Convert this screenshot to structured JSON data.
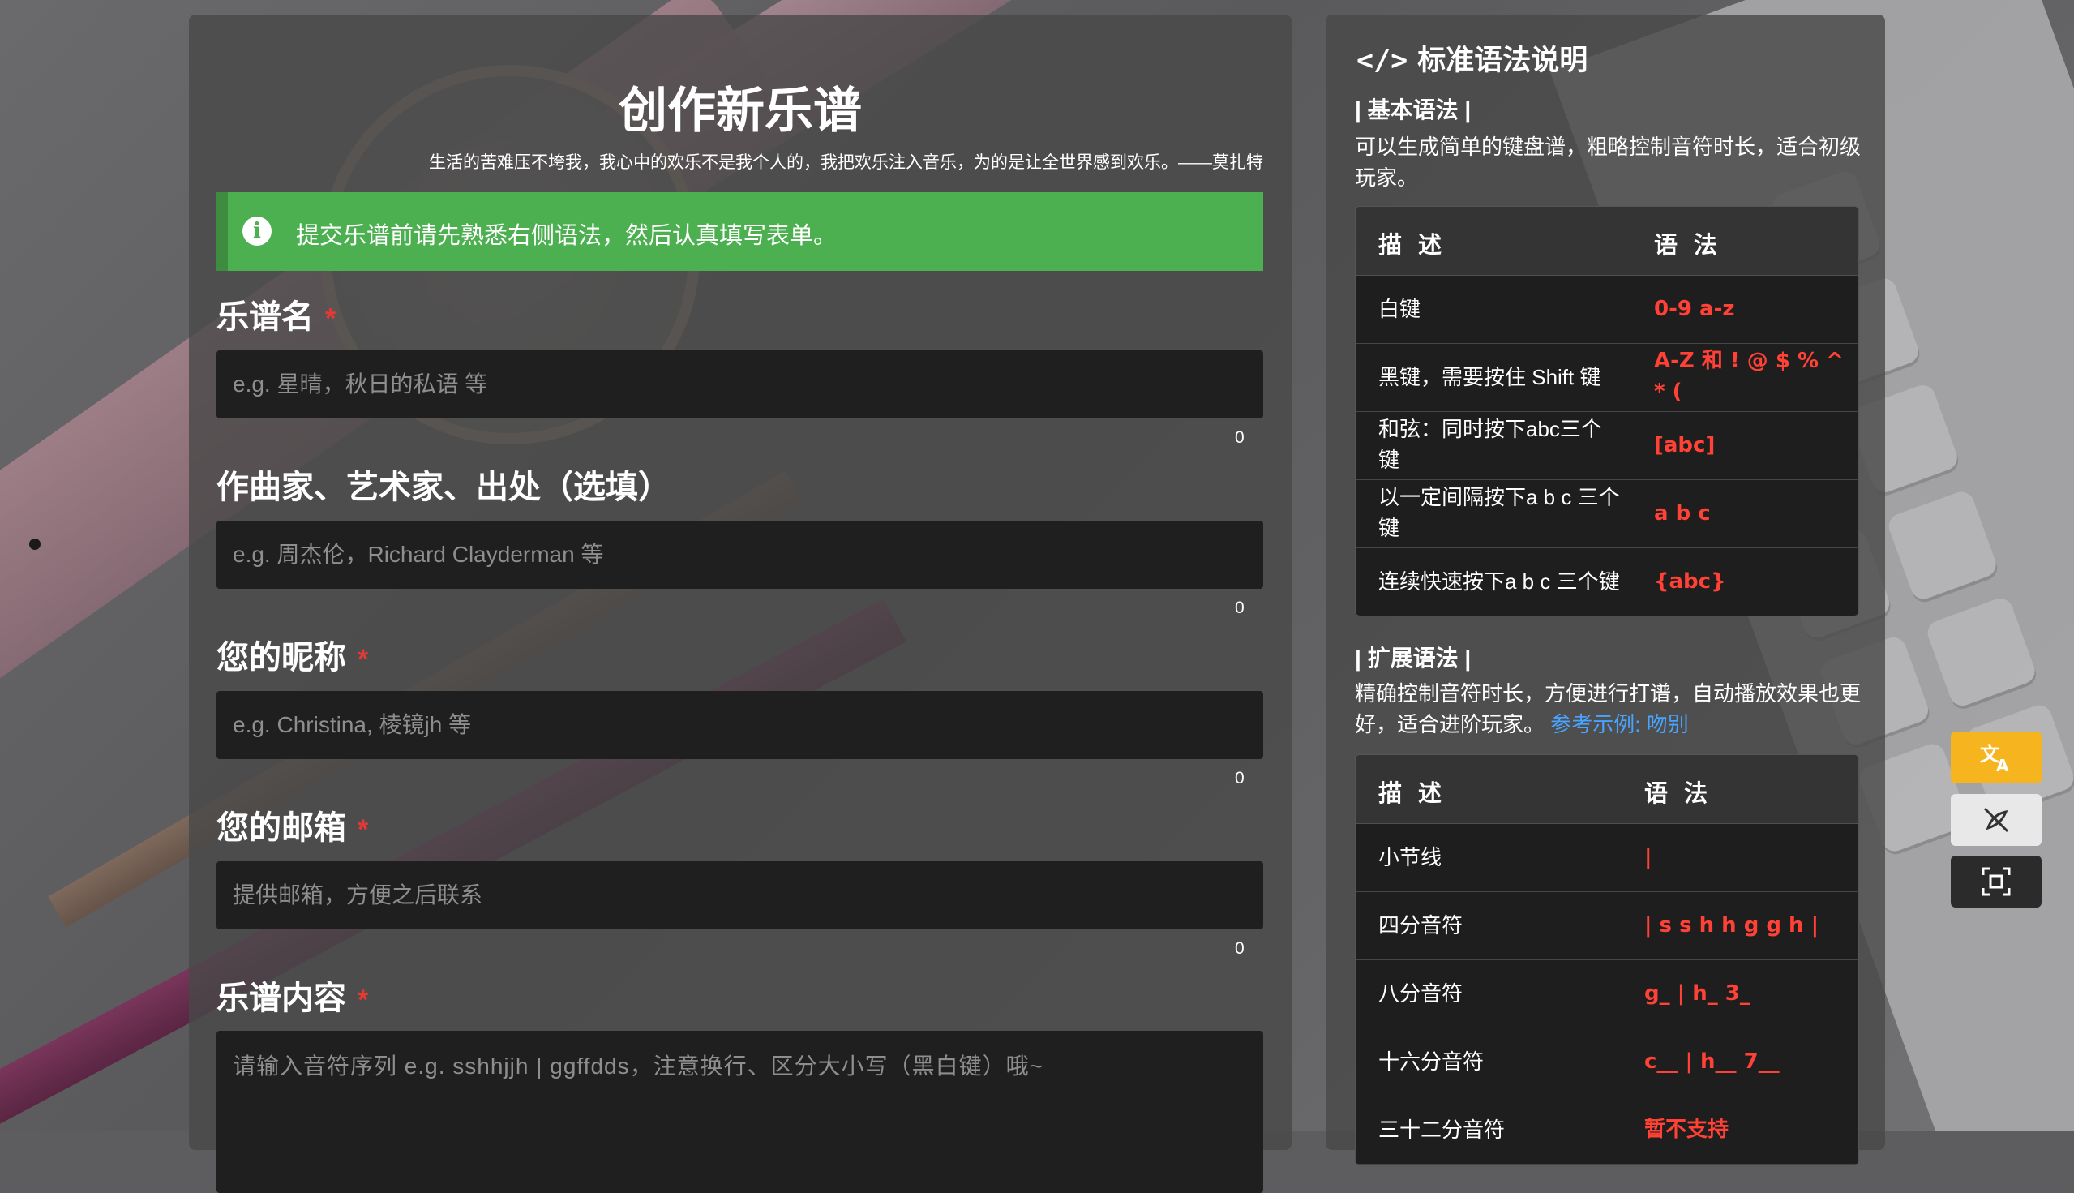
{
  "form": {
    "title": "创作新乐谱",
    "quote": "生活的苦难压不垮我，我心中的欢乐不是我个人的，我把欢乐注入音乐，为的是让全世界感到欢乐。——莫扎特",
    "alert": {
      "icon": "info-icon",
      "text": "提交乐谱前请先熟悉右侧语法，然后认真填写表单。"
    },
    "required_mark": "*",
    "fields": [
      {
        "label": "乐谱名",
        "required": true,
        "placeholder": "e.g. 星晴，秋日的私语 等",
        "value": "",
        "count": "0"
      },
      {
        "label": "作曲家、艺术家、出处（选填）",
        "required": false,
        "placeholder": "e.g. 周杰伦，Richard Clayderman 等",
        "value": "",
        "count": "0"
      },
      {
        "label": "您的昵称",
        "required": true,
        "placeholder": "e.g. Christina, 棱镜jh 等",
        "value": "",
        "count": "0"
      },
      {
        "label": "您的邮箱",
        "required": true,
        "placeholder": "提供邮箱，方便之后联系",
        "value": "",
        "count": "0"
      }
    ],
    "content": {
      "label": "乐谱内容",
      "required": true,
      "placeholder": "请输入音符序列 e.g. sshhjjh | ggffdds，注意换行、区分大小写（黑白键）哦~",
      "value": ""
    }
  },
  "syntax": {
    "title_icon": "code-icon",
    "title": "标准语法说明",
    "basic": {
      "heading": "| 基本语法 |",
      "desc": "可以生成简单的键盘谱，粗略控制音符时长，适合初级玩家。",
      "headers": [
        "描 述",
        "语 法"
      ],
      "rows": [
        {
          "desc": "白键",
          "syntax": "0-9 a-z"
        },
        {
          "desc": "黑键，需要按住 Shift 键",
          "syntax": "A-Z 和 ! @ $ % ^ * ("
        },
        {
          "desc": "和弦：同时按下abc三个键",
          "syntax": "[abc]"
        },
        {
          "desc": "以一定间隔按下a b c 三个键",
          "syntax": "a b c"
        },
        {
          "desc": "连续快速按下a b c 三个键",
          "syntax": "{abc}"
        }
      ]
    },
    "extended": {
      "heading": "| 扩展语法 |",
      "desc": "精确控制音符时长，方便进行打谱，自动播放效果也更好，适合进阶玩家。",
      "link": "参考示例: 吻别",
      "headers": [
        "描 述",
        "语 法"
      ],
      "rows": [
        {
          "desc": "小节线",
          "syntax": "|"
        },
        {
          "desc": "四分音符",
          "syntax": "| s s h h g g h |"
        },
        {
          "desc": "八分音符",
          "syntax": "g_ | h_ 3_"
        },
        {
          "desc": "十六分音符",
          "syntax": "c__ | h__ 7__"
        },
        {
          "desc": "三十二分音符",
          "syntax": "暂不支持"
        }
      ]
    }
  },
  "floating_buttons": [
    {
      "name": "translate-button",
      "icon": "translate-icon",
      "color": "#f6b41f"
    },
    {
      "name": "style-toggle-button",
      "icon": "no-style-icon",
      "color": "#e8e8e8"
    },
    {
      "name": "screenshot-button",
      "icon": "screenshot-icon",
      "color": "#2b2b2b"
    }
  ],
  "colors": {
    "alert_green": "#4caf50",
    "required_red": "#e53935",
    "syntax_red": "#ff4136",
    "link_blue": "#4aa3ff"
  }
}
